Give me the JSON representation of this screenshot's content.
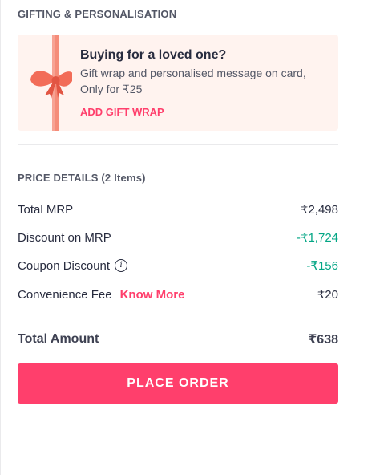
{
  "gifting": {
    "section_title": "GIFTING & PERSONALISATION",
    "heading": "Buying for a loved one?",
    "description": "Gift wrap and personalised message on card, Only for ₹25",
    "add_gift_wrap": "ADD GIFT WRAP"
  },
  "price_details": {
    "section_title": "PRICE DETAILS (2 Items)",
    "rows": [
      {
        "label": "Total MRP",
        "value": "₹2,498"
      },
      {
        "label": "Discount on MRP",
        "value": "-₹1,724"
      },
      {
        "label": "Coupon Discount",
        "value": "-₹156"
      },
      {
        "label": "Convenience Fee",
        "value": "₹20",
        "link": "Know More"
      }
    ],
    "total_label": "Total Amount",
    "total_value": "₹638"
  },
  "actions": {
    "place_order": "PLACE ORDER"
  },
  "colors": {
    "accent": "#ff3f6c",
    "discount_green": "#03a685",
    "gift_card_bg": "#fff3ef"
  },
  "icons": {
    "gift": "gift-ribbon-icon",
    "info": "info-icon"
  }
}
